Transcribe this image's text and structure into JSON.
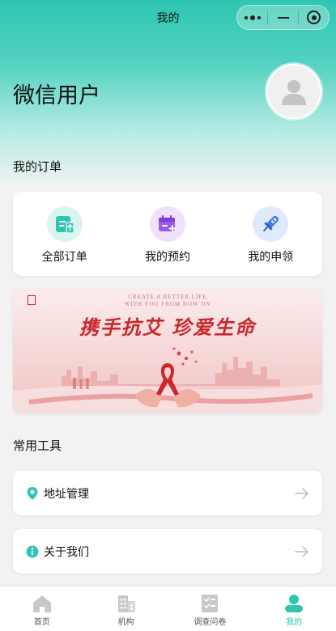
{
  "nav": {
    "title": "我的"
  },
  "profile": {
    "username": "微信用户"
  },
  "orders": {
    "section_title": "我的订单",
    "items": [
      {
        "label": "全部订单",
        "icon": "order-list-icon",
        "color": "#2ec6b1",
        "bg": "#d9f5f0"
      },
      {
        "label": "我的预约",
        "icon": "calendar-plus-icon",
        "color": "#9a5be6",
        "bg": "#eee3fb"
      },
      {
        "label": "我的申领",
        "icon": "syringe-icon",
        "color": "#3d7be8",
        "bg": "#e0eafc"
      }
    ]
  },
  "banner": {
    "subtitle_1": "CREATE A BETTER LIFE",
    "subtitle_2": "WITH YOU FROM NOW ON",
    "headline": "携手抗艾 珍爱生命"
  },
  "tools": {
    "section_title": "常用工具",
    "items": [
      {
        "label": "地址管理",
        "icon": "location-pin-icon"
      },
      {
        "label": "关于我们",
        "icon": "info-icon"
      }
    ]
  },
  "tabbar": {
    "active_color": "#2ec6b1",
    "items": [
      {
        "label": "首页",
        "icon": "home-icon"
      },
      {
        "label": "机构",
        "icon": "building-icon"
      },
      {
        "label": "调查问卷",
        "icon": "checklist-icon"
      },
      {
        "label": "我的",
        "icon": "user-icon",
        "active": true
      }
    ]
  }
}
